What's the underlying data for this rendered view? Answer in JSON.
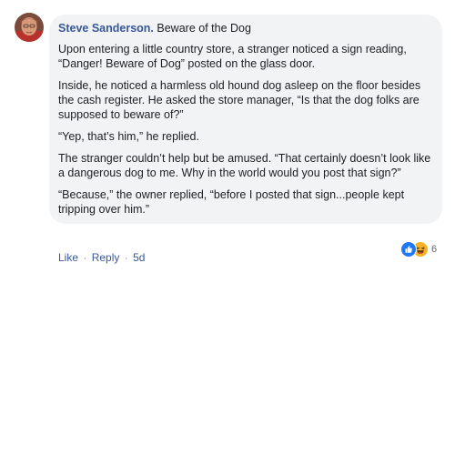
{
  "comment": {
    "author": "Steve Sanderson.",
    "title": "Beware of the Dog",
    "paragraphs": [
      "Upon entering a little country store, a stranger noticed a sign reading, “Danger! Beware of Dog” posted on the glass door.",
      "Inside, he noticed a harmless old hound dog asleep on the floor besides the cash register. He asked the store manager, “Is that the dog folks are supposed to beware of?”",
      "“Yep, that’s him,” he replied.",
      "The stranger couldn’t help but be amused. “That certainly doesn’t look like a dangerous dog to me. Why in the world would you post that sign?”",
      "“Because,” the owner replied, “before I posted that sign...people kept tripping over him.”"
    ],
    "reactions": {
      "icons": [
        "like-icon",
        "haha-icon"
      ],
      "count": "6",
      "like_color": "#2078f4",
      "haha_color": "#f7b125"
    },
    "actions": {
      "like_label": "Like",
      "separator": "·",
      "reply_label": "Reply",
      "time": "5d"
    }
  },
  "colors": {
    "author": "#385898",
    "bubble_bg": "#f2f3f5",
    "text": "#1c1e21",
    "meta": "#606770"
  }
}
